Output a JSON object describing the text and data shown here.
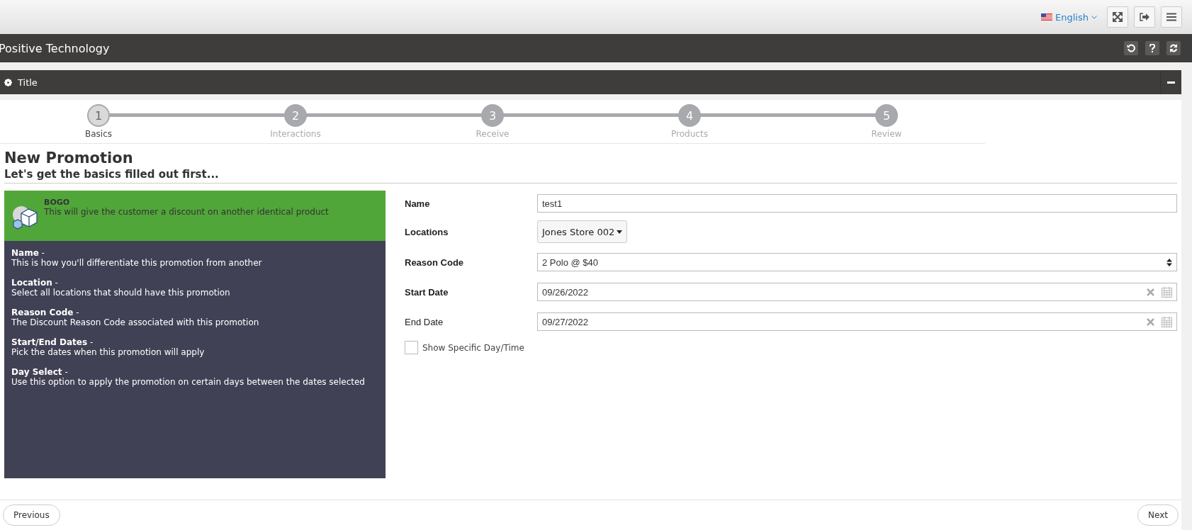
{
  "top_bar": {
    "language": "English"
  },
  "app_header": {
    "title": "Positive Technology"
  },
  "panel": {
    "title": "Title"
  },
  "steps": [
    {
      "number": "1",
      "label": "Basics",
      "selected": true
    },
    {
      "number": "2",
      "label": "Interactions",
      "selected": false
    },
    {
      "number": "3",
      "label": "Receive",
      "selected": false
    },
    {
      "number": "4",
      "label": "Products",
      "selected": false
    },
    {
      "number": "5",
      "label": "Review",
      "selected": false
    }
  ],
  "heading": "New Promotion",
  "subheading": "Let's get the basics filled out first...",
  "promo_type": {
    "name": "BOGO",
    "description": "This will give the customer a discount on another identical product"
  },
  "help": [
    {
      "term": "**Name** -",
      "text": "This is how you'll differentiate this promotion from another"
    },
    {
      "term": "**Location** -",
      "text": "Select all locations that should have this promotion"
    },
    {
      "term": "**Reason Code** -",
      "text": "The Discount Reason Code associated with this promotion"
    },
    {
      "term": "**Start/End Dates** -",
      "text": "Pick the dates when this promotion will apply"
    },
    {
      "term": "**Day Select** -",
      "text": "Use this option to apply the promotion on certain days between the dates selected"
    }
  ],
  "fields": [
    {
      "kind": "text",
      "label": "Name",
      "required": true,
      "value": "test1"
    },
    {
      "kind": "dropdown",
      "label": "Locations",
      "required": true,
      "value": "Jones Store 002"
    },
    {
      "kind": "select",
      "label": "Reason Code",
      "required": true,
      "value": "2 Polo @ $40"
    },
    {
      "kind": "date",
      "label": "Start Date",
      "required": true,
      "value": "09/26/2022"
    },
    {
      "kind": "date",
      "label": "End Date",
      "required": false,
      "value": "09/27/2022"
    }
  ],
  "show_specific": {
    "label": "Show Specific Day/Time",
    "checked": false
  },
  "footer": {
    "previous": "Previous",
    "next": "Next"
  }
}
